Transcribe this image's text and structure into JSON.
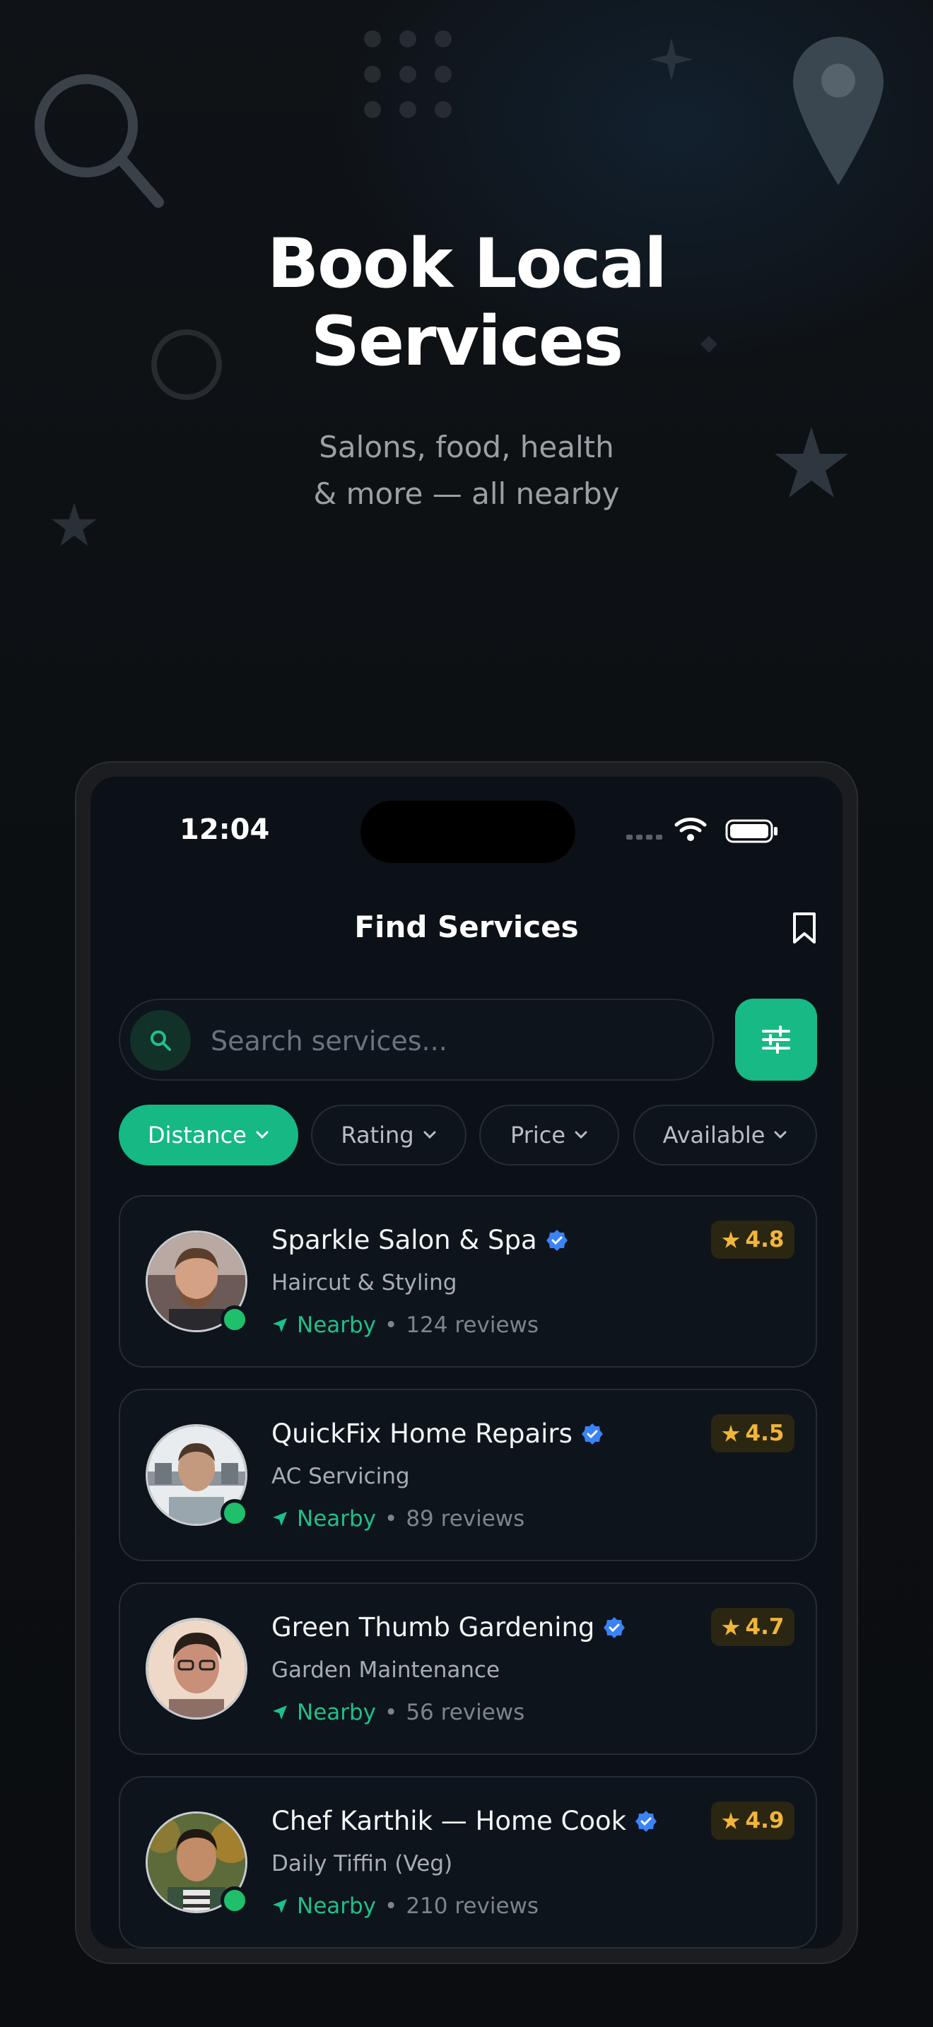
{
  "hero": {
    "title_line1": "Book Local",
    "title_line2": "Services",
    "subtitle_line1": "Salons, food, health",
    "subtitle_line2": "& more — all nearby"
  },
  "status_bar": {
    "time": "12:04"
  },
  "header": {
    "title": "Find Services",
    "bookmark_icon": "bookmark-icon"
  },
  "search": {
    "placeholder": "Search services...",
    "icon": "search-icon",
    "filter_icon": "sliders-icon"
  },
  "filters": [
    {
      "label": "Distance",
      "active": true
    },
    {
      "label": "Rating",
      "active": false
    },
    {
      "label": "Price",
      "active": false
    },
    {
      "label": "Available",
      "active": false
    }
  ],
  "providers": [
    {
      "name": "Sparkle Salon & Spa",
      "category": "Haircut & Styling",
      "distance": "Nearby",
      "reviews": "124 reviews",
      "rating": "4.8",
      "verified": true,
      "online": true
    },
    {
      "name": "QuickFix Home Repairs",
      "category": "AC Servicing",
      "distance": "Nearby",
      "reviews": "89 reviews",
      "rating": "4.5",
      "verified": true,
      "online": true
    },
    {
      "name": "Green Thumb Gardening",
      "category": "Garden Maintenance",
      "distance": "Nearby",
      "reviews": "56 reviews",
      "rating": "4.7",
      "verified": true,
      "online": false
    },
    {
      "name": "Chef Karthik — Home Cook",
      "category": "Daily Tiffin (Veg)",
      "distance": "Nearby",
      "reviews": "210 reviews",
      "rating": "4.9",
      "verified": true,
      "online": true
    }
  ],
  "colors": {
    "accent": "#17b984",
    "verified": "#3b82f6",
    "rating": "#f2b53a",
    "online": "#1fbf6b"
  }
}
